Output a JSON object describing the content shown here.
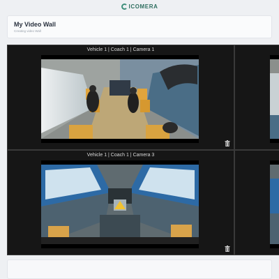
{
  "brand": {
    "name": "ICOMERA"
  },
  "header": {
    "title": "My Video Wall",
    "subtitle": "Creating video Wall"
  },
  "cameras": [
    {
      "label": "Vehicle 1 | Coach 1 | Camera 1",
      "delete_icon": "trash-icon"
    },
    {
      "label": "",
      "delete_icon": ""
    },
    {
      "label": "Vehicle 1 | Coach 1 | Camera 3",
      "delete_icon": "trash-icon"
    },
    {
      "label": "",
      "delete_icon": ""
    }
  ],
  "colors": {
    "brand": "#2f6f60",
    "wall_bg": "#1a1a1a",
    "page_bg": "#eef0f3"
  }
}
